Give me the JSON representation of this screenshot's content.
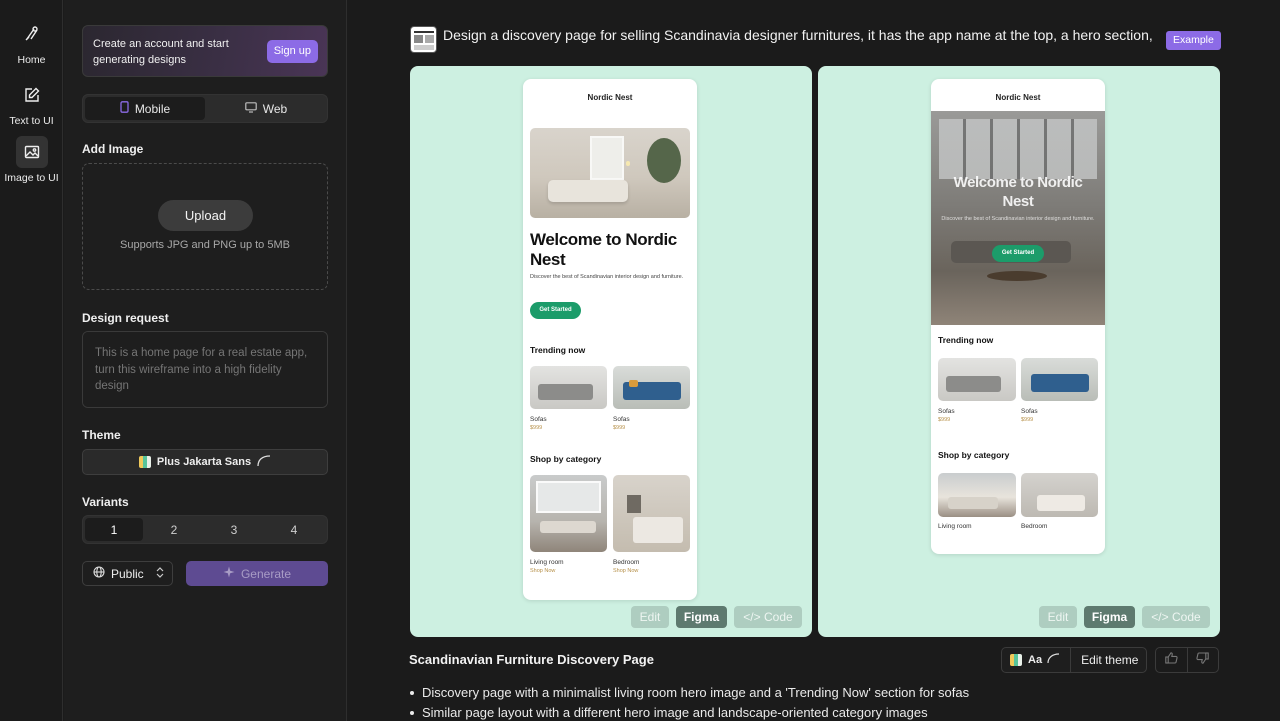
{
  "rail": {
    "items": [
      {
        "label": "Home",
        "icon": "home-icon"
      },
      {
        "label": "Text to UI",
        "icon": "edit-icon"
      },
      {
        "label": "Image to UI",
        "icon": "image-icon"
      }
    ]
  },
  "panel": {
    "signup_text": "Create an account and start generating designs",
    "signup_button": "Sign up",
    "device_options": [
      "Mobile",
      "Web"
    ],
    "add_image_label": "Add Image",
    "upload_button": "Upload",
    "upload_hint": "Supports JPG and PNG up to 5MB",
    "design_request_label": "Design request",
    "design_request_placeholder": "This is a home page for a real estate app, turn this wireframe into a high fidelity design",
    "theme_label": "Theme",
    "theme_font": "Plus Jakarta Sans",
    "variants_label": "Variants",
    "variants": [
      "1",
      "2",
      "3",
      "4"
    ],
    "visibility": "Public",
    "generate_button": "Generate"
  },
  "main": {
    "prompt": "Design a discovery page for selling Scandinavia designer furnitures, it has the app name at the top, a hero section, a...",
    "badge": "Example",
    "designs": [
      {
        "app_name": "Nordic Nest",
        "hero_title": "Welcome to Nordic Nest",
        "hero_subtitle": "Discover the best of Scandinavian interior design and furniture.",
        "cta": "Get Started",
        "trending_heading": "Trending now",
        "trending": [
          {
            "name": "Sofas",
            "price": "$999"
          },
          {
            "name": "Sofas",
            "price": "$999"
          }
        ],
        "category_heading": "Shop by category",
        "categories": [
          {
            "name": "Living room",
            "link": "Shop Now"
          },
          {
            "name": "Bedroom",
            "link": "Shop Now"
          }
        ]
      },
      {
        "app_name": "Nordic Nest",
        "hero_title": "Welcome to Nordic Nest",
        "hero_subtitle": "Discover the best of Scandinavian interior design and furniture.",
        "cta": "Get Started",
        "trending_heading": "Trending now",
        "trending": [
          {
            "name": "Sofas",
            "price": "$999"
          },
          {
            "name": "Sofas",
            "price": "$999"
          }
        ],
        "category_heading": "Shop by category",
        "categories": [
          {
            "name": "Living room"
          },
          {
            "name": "Bedroom"
          }
        ]
      }
    ],
    "card_actions": [
      "Edit",
      "Figma",
      "Code"
    ],
    "result_title": "Scandinavian Furniture Discovery Page",
    "theme_chip_text": "Aa",
    "edit_theme": "Edit theme",
    "bullets": [
      "Discovery page with a minimalist living room hero image and a 'Trending Now' section for sofas",
      "Similar page layout with a different hero image and landscape-oriented category images"
    ]
  },
  "colors": {
    "accent": "#8c6be6",
    "card_bg": "#cdf0e1",
    "cta_green": "#1c9c6a"
  }
}
